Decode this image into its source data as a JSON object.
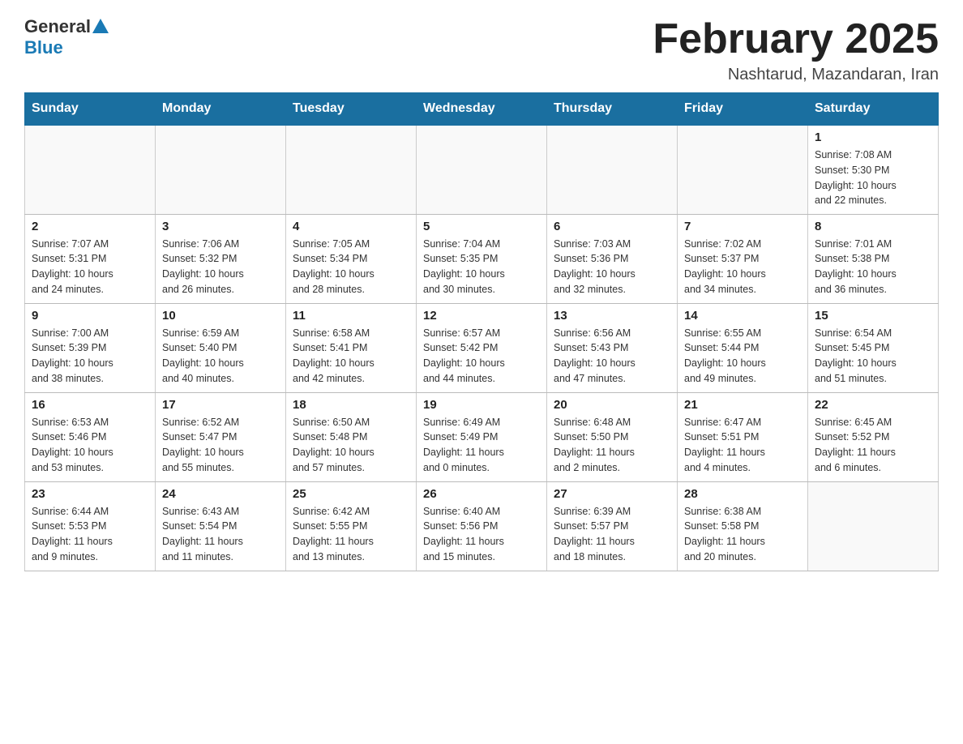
{
  "header": {
    "logo_general": "General",
    "logo_blue": "Blue",
    "month_title": "February 2025",
    "subtitle": "Nashtarud, Mazandaran, Iran"
  },
  "days_of_week": [
    "Sunday",
    "Monday",
    "Tuesday",
    "Wednesday",
    "Thursday",
    "Friday",
    "Saturday"
  ],
  "weeks": [
    {
      "days": [
        {
          "date": "",
          "info": ""
        },
        {
          "date": "",
          "info": ""
        },
        {
          "date": "",
          "info": ""
        },
        {
          "date": "",
          "info": ""
        },
        {
          "date": "",
          "info": ""
        },
        {
          "date": "",
          "info": ""
        },
        {
          "date": "1",
          "info": "Sunrise: 7:08 AM\nSunset: 5:30 PM\nDaylight: 10 hours\nand 22 minutes."
        }
      ]
    },
    {
      "days": [
        {
          "date": "2",
          "info": "Sunrise: 7:07 AM\nSunset: 5:31 PM\nDaylight: 10 hours\nand 24 minutes."
        },
        {
          "date": "3",
          "info": "Sunrise: 7:06 AM\nSunset: 5:32 PM\nDaylight: 10 hours\nand 26 minutes."
        },
        {
          "date": "4",
          "info": "Sunrise: 7:05 AM\nSunset: 5:34 PM\nDaylight: 10 hours\nand 28 minutes."
        },
        {
          "date": "5",
          "info": "Sunrise: 7:04 AM\nSunset: 5:35 PM\nDaylight: 10 hours\nand 30 minutes."
        },
        {
          "date": "6",
          "info": "Sunrise: 7:03 AM\nSunset: 5:36 PM\nDaylight: 10 hours\nand 32 minutes."
        },
        {
          "date": "7",
          "info": "Sunrise: 7:02 AM\nSunset: 5:37 PM\nDaylight: 10 hours\nand 34 minutes."
        },
        {
          "date": "8",
          "info": "Sunrise: 7:01 AM\nSunset: 5:38 PM\nDaylight: 10 hours\nand 36 minutes."
        }
      ]
    },
    {
      "days": [
        {
          "date": "9",
          "info": "Sunrise: 7:00 AM\nSunset: 5:39 PM\nDaylight: 10 hours\nand 38 minutes."
        },
        {
          "date": "10",
          "info": "Sunrise: 6:59 AM\nSunset: 5:40 PM\nDaylight: 10 hours\nand 40 minutes."
        },
        {
          "date": "11",
          "info": "Sunrise: 6:58 AM\nSunset: 5:41 PM\nDaylight: 10 hours\nand 42 minutes."
        },
        {
          "date": "12",
          "info": "Sunrise: 6:57 AM\nSunset: 5:42 PM\nDaylight: 10 hours\nand 44 minutes."
        },
        {
          "date": "13",
          "info": "Sunrise: 6:56 AM\nSunset: 5:43 PM\nDaylight: 10 hours\nand 47 minutes."
        },
        {
          "date": "14",
          "info": "Sunrise: 6:55 AM\nSunset: 5:44 PM\nDaylight: 10 hours\nand 49 minutes."
        },
        {
          "date": "15",
          "info": "Sunrise: 6:54 AM\nSunset: 5:45 PM\nDaylight: 10 hours\nand 51 minutes."
        }
      ]
    },
    {
      "days": [
        {
          "date": "16",
          "info": "Sunrise: 6:53 AM\nSunset: 5:46 PM\nDaylight: 10 hours\nand 53 minutes."
        },
        {
          "date": "17",
          "info": "Sunrise: 6:52 AM\nSunset: 5:47 PM\nDaylight: 10 hours\nand 55 minutes."
        },
        {
          "date": "18",
          "info": "Sunrise: 6:50 AM\nSunset: 5:48 PM\nDaylight: 10 hours\nand 57 minutes."
        },
        {
          "date": "19",
          "info": "Sunrise: 6:49 AM\nSunset: 5:49 PM\nDaylight: 11 hours\nand 0 minutes."
        },
        {
          "date": "20",
          "info": "Sunrise: 6:48 AM\nSunset: 5:50 PM\nDaylight: 11 hours\nand 2 minutes."
        },
        {
          "date": "21",
          "info": "Sunrise: 6:47 AM\nSunset: 5:51 PM\nDaylight: 11 hours\nand 4 minutes."
        },
        {
          "date": "22",
          "info": "Sunrise: 6:45 AM\nSunset: 5:52 PM\nDaylight: 11 hours\nand 6 minutes."
        }
      ]
    },
    {
      "days": [
        {
          "date": "23",
          "info": "Sunrise: 6:44 AM\nSunset: 5:53 PM\nDaylight: 11 hours\nand 9 minutes."
        },
        {
          "date": "24",
          "info": "Sunrise: 6:43 AM\nSunset: 5:54 PM\nDaylight: 11 hours\nand 11 minutes."
        },
        {
          "date": "25",
          "info": "Sunrise: 6:42 AM\nSunset: 5:55 PM\nDaylight: 11 hours\nand 13 minutes."
        },
        {
          "date": "26",
          "info": "Sunrise: 6:40 AM\nSunset: 5:56 PM\nDaylight: 11 hours\nand 15 minutes."
        },
        {
          "date": "27",
          "info": "Sunrise: 6:39 AM\nSunset: 5:57 PM\nDaylight: 11 hours\nand 18 minutes."
        },
        {
          "date": "28",
          "info": "Sunrise: 6:38 AM\nSunset: 5:58 PM\nDaylight: 11 hours\nand 20 minutes."
        },
        {
          "date": "",
          "info": ""
        }
      ]
    }
  ]
}
